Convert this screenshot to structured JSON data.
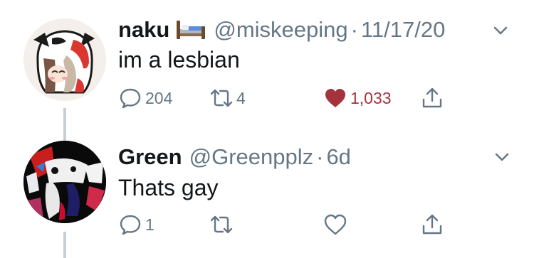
{
  "tweets": [
    {
      "name": "naku",
      "handle": "@miskeeping",
      "separator": "·",
      "date": "11/17/20",
      "text": "im a lesbian",
      "replies": "204",
      "retweets": "4",
      "likes": "1,033",
      "liked": true
    },
    {
      "name": "Green",
      "handle": "@Greenpplz",
      "separator": "·",
      "date": "6d",
      "text": "Thats gay",
      "replies": "1",
      "retweets": "",
      "likes": "",
      "liked": false
    }
  ],
  "colors": {
    "text": "#14171a",
    "secondary": "#657786",
    "liked": "#a4333d",
    "thread_line": "#c4cfd6"
  },
  "icons": [
    "reply-icon",
    "retweet-icon",
    "heart-icon",
    "share-icon",
    "chevron-down-icon",
    "bed-emoji-icon"
  ]
}
